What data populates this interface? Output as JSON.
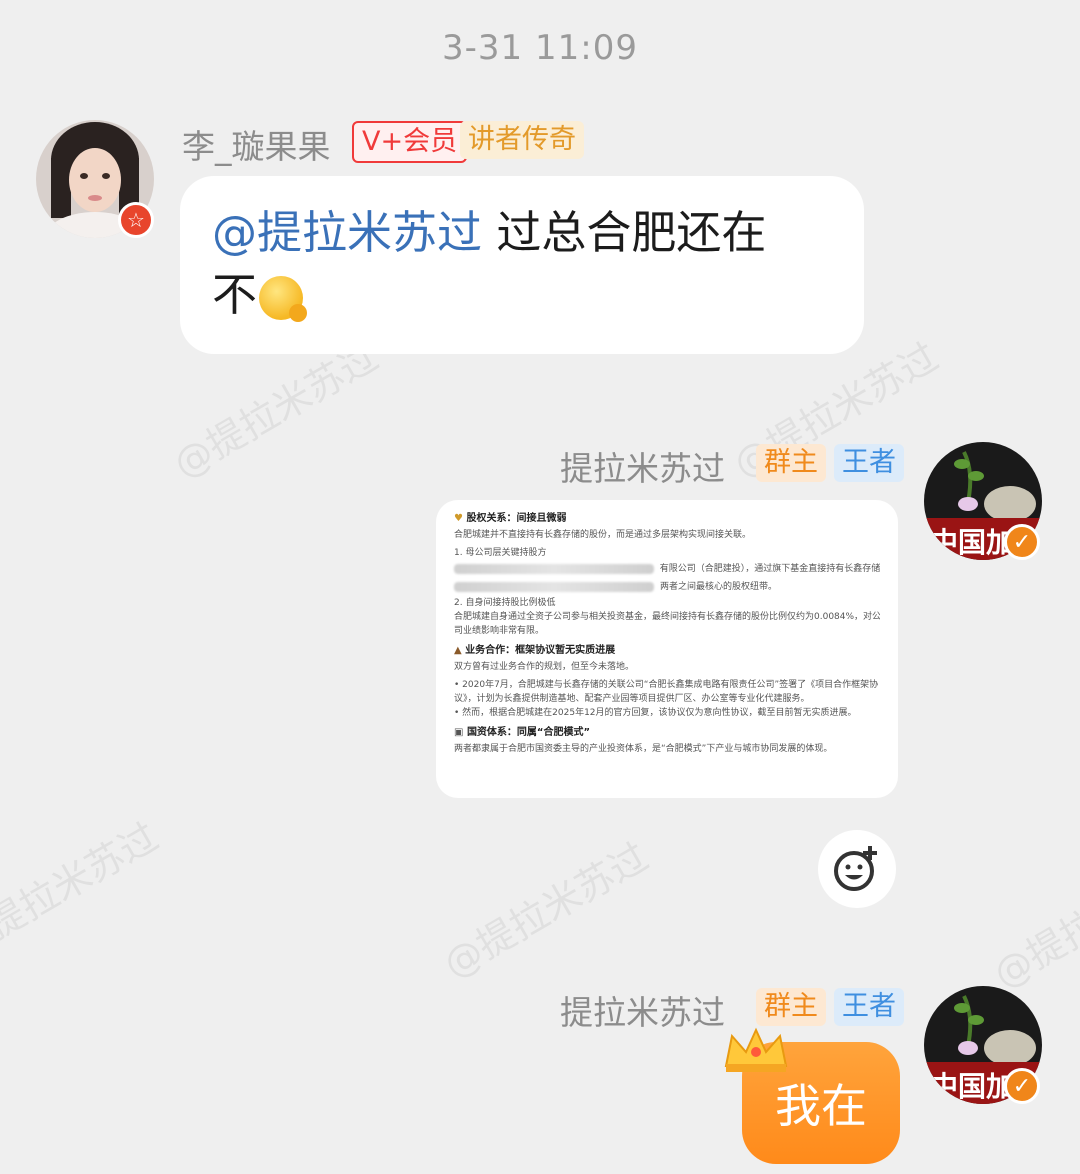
{
  "timestamp": "3-31 11:09",
  "watermark": "@提拉米苏过",
  "messages": [
    {
      "sender": "李_璇果果",
      "tags": [
        "V+会员",
        "讲者传奇"
      ],
      "mention": "@提拉米苏过",
      "text_line1": " 过总合肥还在",
      "text_line2": "不"
    },
    {
      "sender": "提拉米苏过",
      "tags": [
        "群主",
        "王者"
      ],
      "avatar_text": "中国加"
    },
    {
      "sender": "提拉米苏过",
      "tags": [
        "群主",
        "王者"
      ],
      "avatar_text": "中国加",
      "text": "我在"
    }
  ],
  "document": {
    "section1_title": "股权关系：间接且微弱",
    "section1_intro": "合肥城建并不直接持有长鑫存储的股份，而是通过多层架构实现间接关联。",
    "item1": "1. 母公司层关键持股方",
    "item1_detail": "有限公司（合肥建投），通过旗下基金直接持有长鑫存储",
    "item1_detail2": "两者之间最核心的股权纽带。",
    "item2": "2. 自身间接持股比例极低",
    "item2_detail": "合肥城建自身通过全资子公司参与相关投资基金，最终间接持有长鑫存储的股份比例仅约为0.0084%，对公",
    "item2_detail2": "司业绩影响非常有限。",
    "section2_title": "业务合作：框架协议暂无实质进展",
    "section2_intro": "双方曾有过业务合作的规划，但至今未落地。",
    "bullet1": "• 2020年7月，合肥城建与长鑫存储的关联公司“合肥长鑫集成电路有限责任公司”签署了《项目合作框架协",
    "bullet1b": "议》，计划为长鑫提供制造基地、配套产业园等项目提供厂区、办公室等专业化代建服务。",
    "bullet2": "• 然而，根据合肥城建在2025年12月的官方回复，该协议仅为意向性协议，截至目前暂无实质进展。",
    "section3_title": "国资体系：同属“合肥模式”",
    "section3_intro": "两者都隶属于合肥市国资委主导的产业投资体系，是“合肥模式”下产业与城市协同发展的体现。"
  },
  "colors": {
    "background": "#efefef",
    "bubble_self": "#ff9a2e",
    "bubble_other": "#ffffff",
    "mention": "#3a71b8"
  }
}
